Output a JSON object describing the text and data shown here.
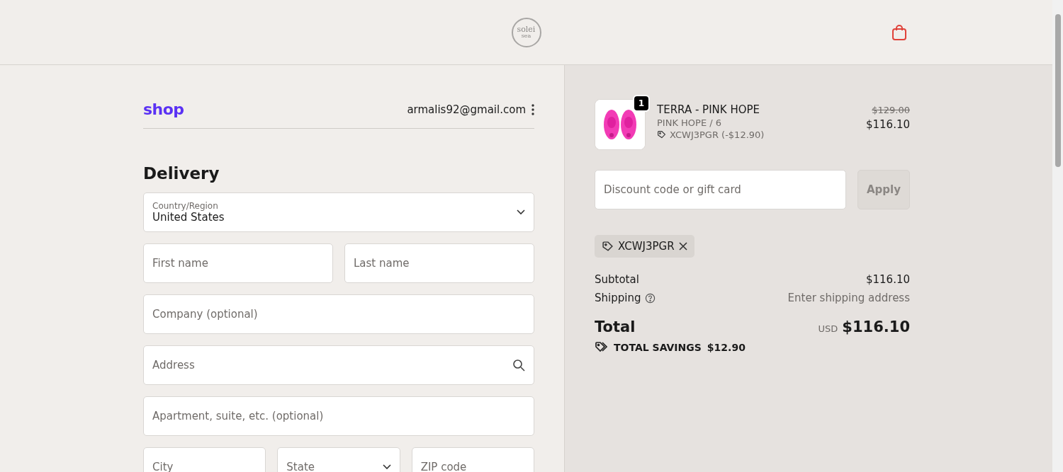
{
  "header": {
    "logo": {
      "name": "solei",
      "sub": "sea"
    }
  },
  "account": {
    "brand": "shop",
    "email": "armalis92@gmail.com"
  },
  "delivery": {
    "title": "Delivery",
    "field_rows": [
      [
        {
          "kind": "select",
          "label": "Country/Region",
          "value": "United States"
        }
      ],
      [
        {
          "kind": "text",
          "placeholder": "First name"
        },
        {
          "kind": "text",
          "placeholder": "Last name"
        }
      ],
      [
        {
          "kind": "text",
          "placeholder": "Company (optional)"
        }
      ],
      [
        {
          "kind": "search",
          "placeholder": "Address"
        }
      ],
      [
        {
          "kind": "text",
          "placeholder": "Apartment, suite, etc. (optional)"
        }
      ],
      [
        {
          "kind": "text",
          "placeholder": "City"
        },
        {
          "kind": "select",
          "placeholder": "State"
        },
        {
          "kind": "text",
          "placeholder": "ZIP code"
        }
      ]
    ]
  },
  "summary": {
    "items": [
      {
        "name": "TERRA - PINK HOPE",
        "variant": "PINK HOPE / 6",
        "discount": "XCWJ3PGR (-$12.90)",
        "quantity": "1",
        "original_price": "$129.00",
        "price": "$116.10"
      }
    ],
    "discount_field": {
      "placeholder": "Discount code or gift card"
    },
    "apply_button": {
      "label": "Apply",
      "disabled": true
    },
    "applied_codes": [
      "XCWJ3PGR"
    ],
    "subtotal": {
      "label": "Subtotal",
      "value": "$116.10"
    },
    "shipping": {
      "label": "Shipping",
      "value": "Enter shipping address"
    },
    "total": {
      "label": "Total",
      "currency": "USD",
      "value": "$116.10"
    },
    "savings": {
      "label": "TOTAL SAVINGS",
      "value": "$12.90"
    }
  }
}
